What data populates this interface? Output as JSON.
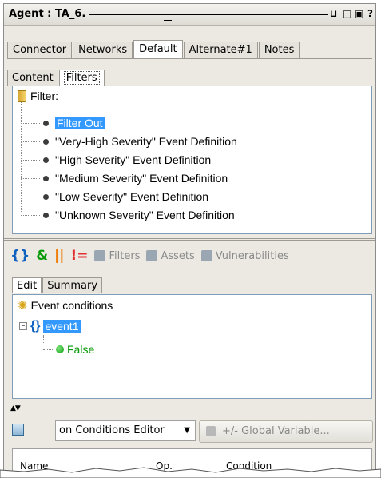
{
  "window": {
    "title": "Agent : TA_6.",
    "controls": [
      "⊔",
      "□",
      "▣",
      "?"
    ]
  },
  "main_tabs": [
    "Connector",
    "Networks",
    "Default",
    "Alternate#1",
    "Notes"
  ],
  "main_active": 2,
  "sub_tabs": [
    "Content",
    "Filters"
  ],
  "sub_active": 1,
  "filter_tree": {
    "root": "Filter:",
    "items": [
      {
        "label": "Filter Out",
        "selected": true
      },
      {
        "label": "\"Very-High Severity\" Event Definition"
      },
      {
        "label": "\"High Severity\" Event Definition"
      },
      {
        "label": "\"Medium Severity\" Event Definition"
      },
      {
        "label": "\"Low Severity\" Event Definition"
      },
      {
        "label": "\"Unknown Severity\" Event Definition"
      }
    ]
  },
  "toolbar": {
    "filters": "Filters",
    "assets": "Assets",
    "vulnerabilities": "Vulnerabilities"
  },
  "edit_tabs": [
    "Edit",
    "Summary"
  ],
  "conditions": {
    "root": "Event conditions",
    "event": "event1",
    "value": "False"
  },
  "bottom": {
    "editor_select": "on Conditions Editor",
    "global_var_button": "+/- Global Variable..."
  },
  "columns": [
    "Name",
    "Op.",
    "Condition"
  ],
  "colors": {
    "selection": "#3399ff",
    "accent_red": "#e03030",
    "accent_orange": "#f07a00",
    "accent_green": "#0a9a0a",
    "brace_blue": "#1060c0"
  }
}
